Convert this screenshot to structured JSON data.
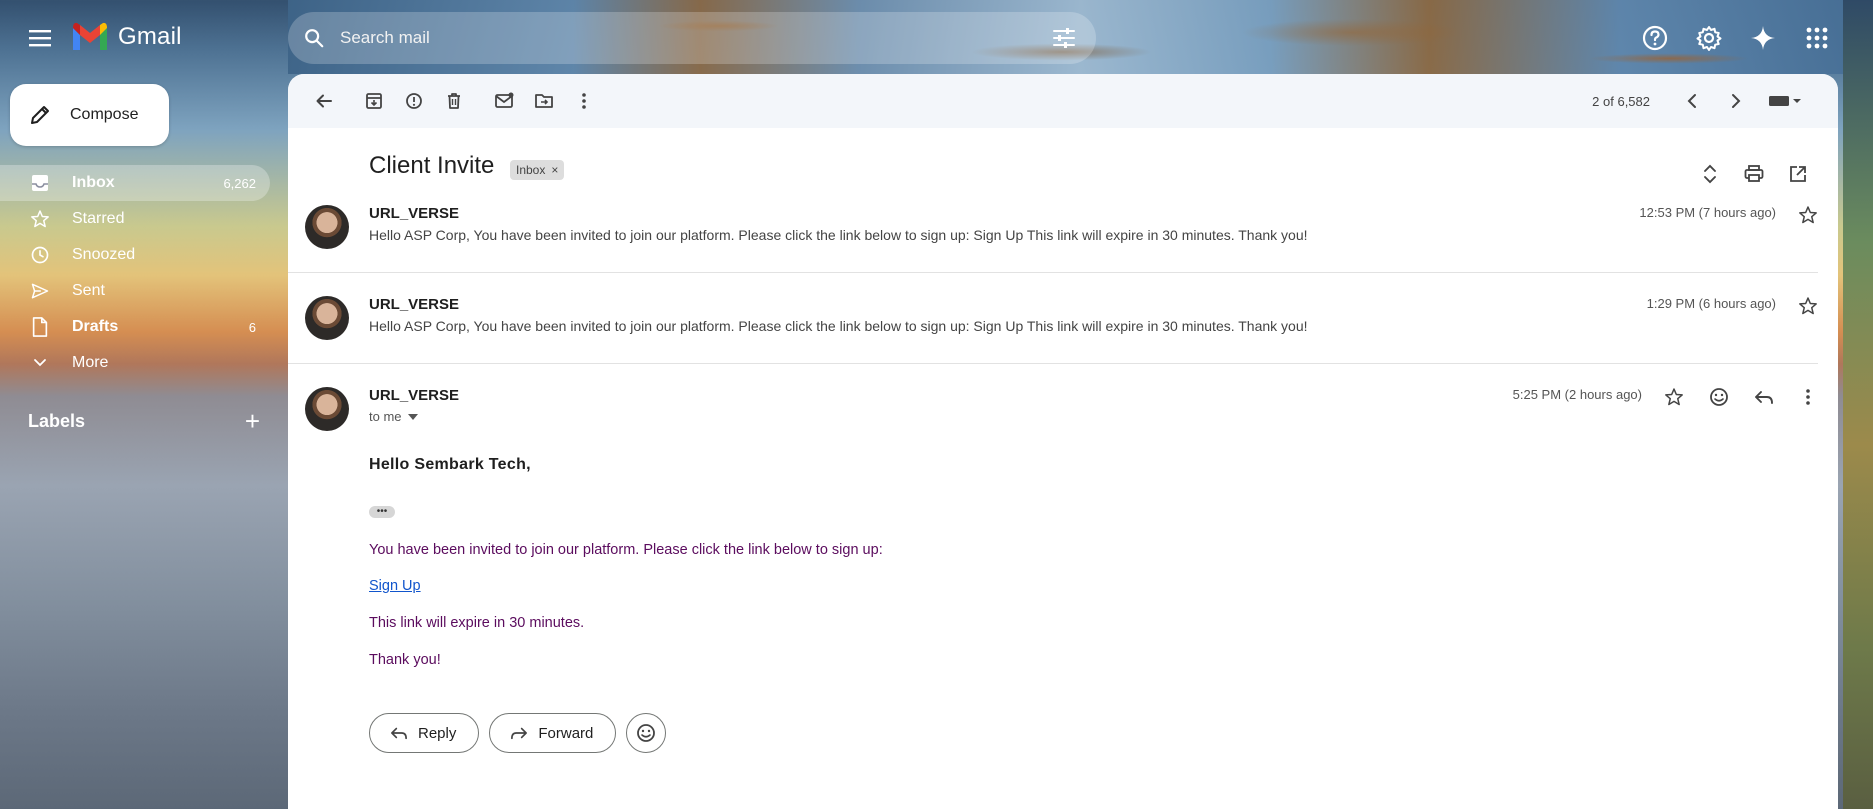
{
  "app": {
    "name": "Gmail"
  },
  "search": {
    "placeholder": "Search mail"
  },
  "sidebar": {
    "compose_label": "Compose",
    "items": [
      {
        "label": "Inbox",
        "count": "6,262",
        "icon": "inbox-icon"
      },
      {
        "label": "Starred",
        "count": "",
        "icon": "star-icon"
      },
      {
        "label": "Snoozed",
        "count": "",
        "icon": "clock-icon"
      },
      {
        "label": "Sent",
        "count": "",
        "icon": "send-icon"
      },
      {
        "label": "Drafts",
        "count": "6",
        "icon": "draft-icon"
      },
      {
        "label": "More",
        "count": "",
        "icon": "chevron-down-icon"
      }
    ],
    "labels_title": "Labels",
    "labels_add": "+"
  },
  "toolbar": {
    "counter": "2 of 6,582"
  },
  "thread": {
    "subject": "Client Invite",
    "label_chip": "Inbox",
    "messages": [
      {
        "sender": "URL_VERSE",
        "snippet": "Hello ASP Corp, You have been invited to join our platform. Please click the link below to sign up: Sign Up This link will expire in 30 minutes. Thank you!",
        "time": "12:53 PM (7 hours ago)"
      },
      {
        "sender": "URL_VERSE",
        "snippet": "Hello ASP Corp, You have been invited to join our platform. Please click the link below to sign up: Sign Up This link will expire in 30 minutes. Thank you!",
        "time": "1:29 PM (6 hours ago)"
      },
      {
        "sender": "URL_VERSE",
        "to": "to me",
        "time": "5:25 PM (2 hours ago)",
        "greeting": "Hello Sembark Tech,",
        "ellipsis": "•••",
        "line1": "You have been invited to join our platform. Please click the link below to sign up:",
        "link": "Sign Up",
        "line2": "This link will expire in 30 minutes.",
        "line3": "Thank you!"
      }
    ],
    "reply_label": "Reply",
    "forward_label": "Forward"
  },
  "colors": {
    "body_text": "#5b0c5e",
    "link": "#1155cc",
    "panel_bg": "#ffffff"
  }
}
